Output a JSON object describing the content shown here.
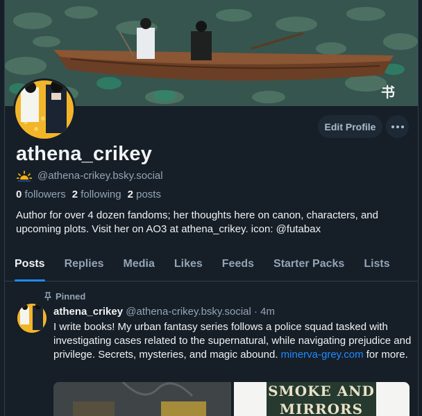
{
  "profile": {
    "display_name": "athena_crikey",
    "handle": "@athena-crikey.bsky.social",
    "handle_icon": "sun-icon",
    "stats": {
      "followers_count": "0",
      "followers_label": "followers",
      "following_count": "2",
      "following_label": "following",
      "posts_count": "2",
      "posts_label": "posts"
    },
    "bio": "Author for over 4 dozen fandoms; her thoughts here on canon, characters, and upcoming plots. Visit her on AO3 at athena_crikey. icon: @futabax",
    "edit_label": "Edit Profile",
    "more_icon": "ellipsis-icon"
  },
  "tabs": [
    {
      "label": "Posts",
      "active": true
    },
    {
      "label": "Replies",
      "active": false
    },
    {
      "label": "Media",
      "active": false
    },
    {
      "label": "Likes",
      "active": false
    },
    {
      "label": "Feeds",
      "active": false
    },
    {
      "label": "Starter Packs",
      "active": false
    },
    {
      "label": "Lists",
      "active": false
    }
  ],
  "post": {
    "pinned_label": "Pinned",
    "pin_icon": "pin-icon",
    "author_name": "athena_crikey",
    "author_handle": "@athena-crikey.bsky.social",
    "separator": "·",
    "time": "4m",
    "text_before_link": "I write books! My urban fantasy series follows a police squad tasked with investigating cases related to the supernatural, while navigating prejudice and privilege. Secrets, mysteries, and magic abound. ",
    "link_text": "minerva-grey.com",
    "text_after_link": " for more.",
    "book_title_line1": "SMOKE AND",
    "book_title_line2": "MIRRORS"
  },
  "colors": {
    "background": "#161e27",
    "accent": "#208bfe",
    "muted": "#93a5b7",
    "avatar_yellow": "#f2b52a"
  }
}
